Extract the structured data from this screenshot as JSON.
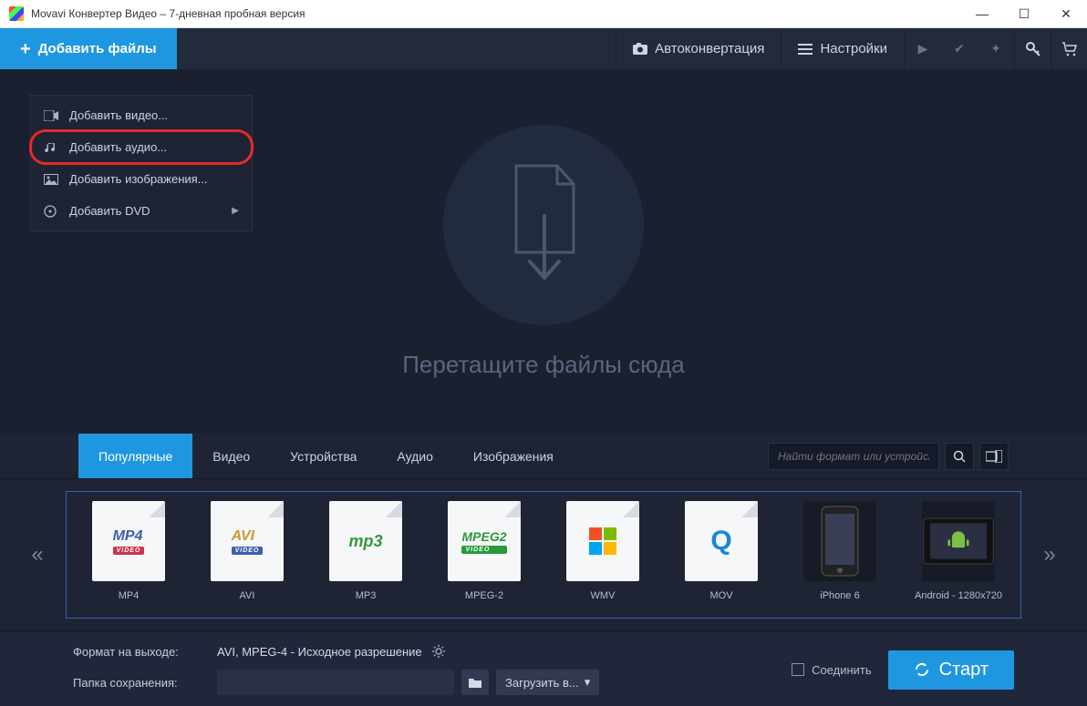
{
  "window": {
    "title": "Movavi Конвертер Видео – 7-дневная пробная версия"
  },
  "topbar": {
    "add_files": "Добавить файлы",
    "autoconvert": "Автоконвертация",
    "settings": "Настройки"
  },
  "dropdown": {
    "add_video": "Добавить видео...",
    "add_audio": "Добавить аудио...",
    "add_images": "Добавить изображения...",
    "add_dvd": "Добавить DVD"
  },
  "dropzone": {
    "text": "Перетащите файлы сюда"
  },
  "tabs": {
    "popular": "Популярные",
    "video": "Видео",
    "devices": "Устройства",
    "audio": "Аудио",
    "images": "Изображения"
  },
  "search": {
    "placeholder": "Найти формат или устройств..."
  },
  "presets": [
    {
      "name": "MP4",
      "tag": "MP4",
      "sub": "VIDEO",
      "color": "#3f5fab"
    },
    {
      "name": "AVI",
      "tag": "AVI",
      "sub": "VIDEO",
      "color": "#d09a2b"
    },
    {
      "name": "MP3",
      "tag": "mp3",
      "sub": "",
      "color": "#2f9a3e"
    },
    {
      "name": "MPEG-2",
      "tag": "MPEG2",
      "sub": "VIDEO",
      "color": "#2a9a3b"
    },
    {
      "name": "WMV",
      "tag": "",
      "sub": "",
      "color": ""
    },
    {
      "name": "MOV",
      "tag": "Q",
      "sub": "",
      "color": "#1a88d6"
    },
    {
      "name": "iPhone 6",
      "tag": "📱",
      "sub": "",
      "color": ""
    },
    {
      "name": "Android - 1280x720",
      "tag": "▸",
      "sub": "",
      "color": "#7bc043"
    }
  ],
  "bottom": {
    "format_label": "Формат на выходе:",
    "format_value": "AVI, MPEG-4 - Исходное разрешение",
    "save_label": "Папка сохранения:",
    "upload": "Загрузить в...",
    "merge": "Соединить",
    "start": "Старт"
  }
}
